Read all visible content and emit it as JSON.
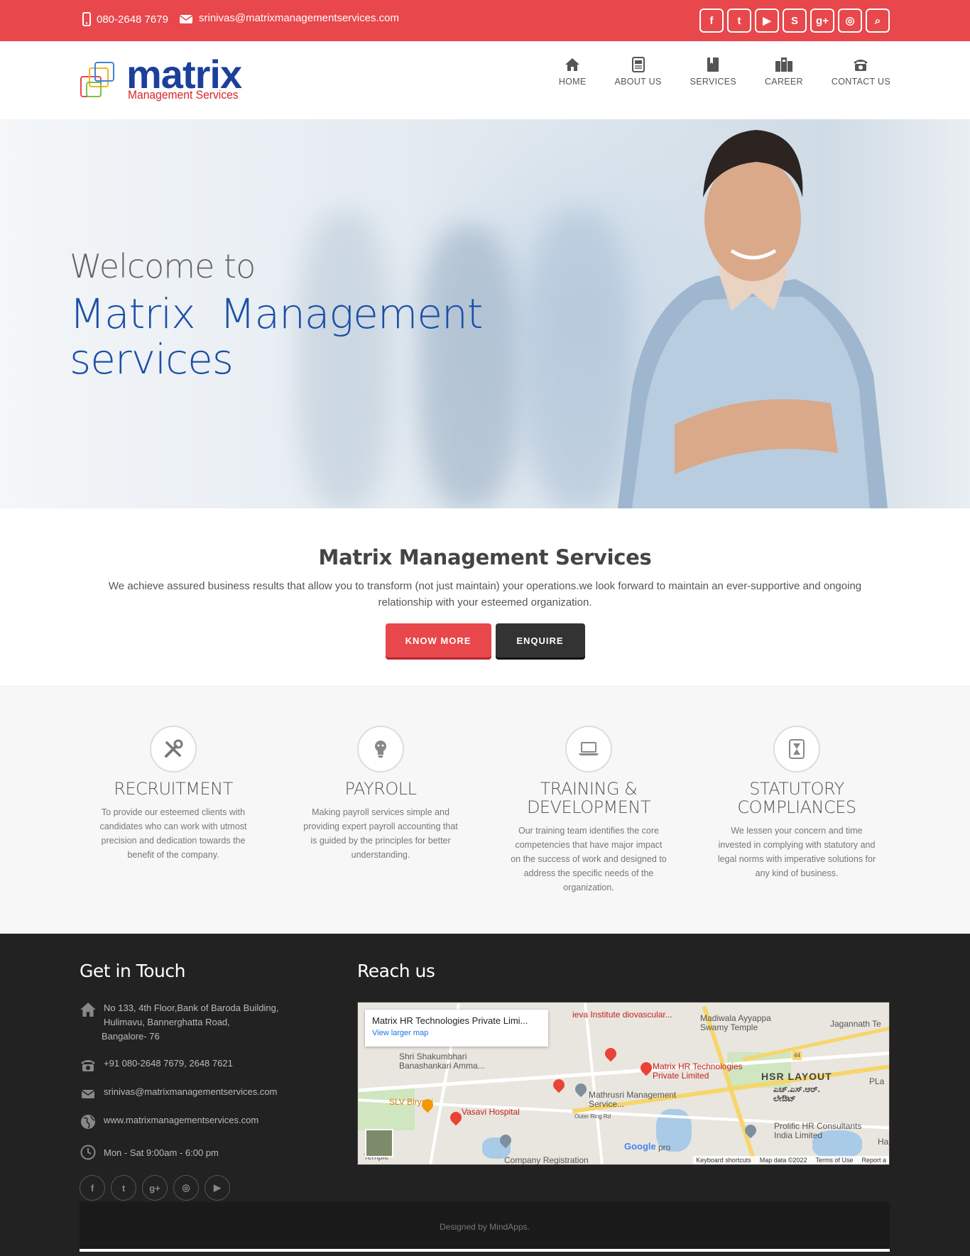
{
  "topbar": {
    "phone": "080-2648 7679",
    "email": "srinivas@matrixmanagementservices.com",
    "social": [
      "f",
      "t",
      "▶",
      "S",
      "g+",
      "◎",
      "⌕"
    ]
  },
  "logo": {
    "name": "matrix",
    "tagline": "Management Services"
  },
  "nav": [
    {
      "label": "HOME",
      "icon": "home-icon"
    },
    {
      "label": "ABOUT US",
      "icon": "document-icon"
    },
    {
      "label": "SERVICES",
      "icon": "book-icon"
    },
    {
      "label": "CAREER",
      "icon": "buildings-icon"
    },
    {
      "label": "CONTACT US",
      "icon": "telephone-icon"
    }
  ],
  "hero": {
    "welcome": "Welcome to",
    "title_line1": "Matrix  Management",
    "title_line2": "services"
  },
  "intro": {
    "title": "Matrix Management Services",
    "text": "We achieve assured business results that allow you to transform (not just maintain) your operations.we look forward to maintain an ever-supportive and ongoing relationship with your esteemed organization.",
    "know_more": "KNOW MORE",
    "enquire": "ENQUIRE"
  },
  "services": [
    {
      "title": "RECRUITMENT",
      "icon": "tools-icon",
      "text": "To provide our esteemed clients with candidates who can work with utmost precision and dedication towards the benefit of the company."
    },
    {
      "title": "PAYROLL",
      "icon": "lightbulb-icon",
      "text": "Making payroll services simple and providing expert payroll accounting that is guided by the principles for better understanding."
    },
    {
      "title": "TRAINING & DEVELOPMENT",
      "icon": "laptop-icon",
      "text": "Our training team identifies the core competencies that have major impact on the success of work and designed to address the specific needs of the organization."
    },
    {
      "title": "STATUTORY COMPLIANCES",
      "icon": "hourglass-icon",
      "text": "We lessen your concern and time invested in complying with statutory and legal norms with imperative solutions for any kind of business."
    }
  ],
  "footer": {
    "get_in_touch": "Get in Touch",
    "reach_us": "Reach us",
    "address_line1": "No 133, 4th Floor,Bank of Baroda Building,",
    "address_line2": "Hulimavu, Bannerghatta Road,",
    "address_line3": "Bangalore- 76",
    "phones": "+91 080-2648 7679, 2648 7621",
    "email": "srinivas@matrixmanagementservices.com",
    "website": "www.matrixmanagementservices.com",
    "hours": "Mon - Sat 9:00am - 6:00 pm",
    "social": [
      "f",
      "t",
      "g+",
      "◎",
      "▶"
    ],
    "designed_by": "Designed by MindApps."
  },
  "map": {
    "card_title": "Matrix HR Technologies Private Limi...",
    "card_link": "View larger map",
    "labels": {
      "institute": "ieva Institute diovascular...",
      "madiwala": "Madiwala Ayyappa Swamy Temple",
      "jagannath": "Jagannath Te",
      "shakumbhari": "Shri Shakumbhari Banashankari Amma...",
      "matrix_hr": "Matrix HR Technologies Private Limited",
      "hsr": "HSR LAYOUT",
      "hsr_kn": "ಎಚ್.ಎಸ್.ಆರ್. ಲೇಔಟ್",
      "pla": "PLa",
      "slv": "SLV Biryani",
      "vasavi": "Vasavi Hospital",
      "mathrusri": "Mathrusri Management Service...",
      "prolific": "Prolific HR Consultants India Limited",
      "company_reg": "Company Registration",
      "outer_ring": "Outer Ring Rd",
      "road_44": "44",
      "temple": "Temple",
      "google": "Google",
      "pro": "pro",
      "ha": "Ha"
    },
    "attribution": [
      "Keyboard shortcuts",
      "Map data ©2022",
      "Terms of Use",
      "Report a"
    ]
  }
}
